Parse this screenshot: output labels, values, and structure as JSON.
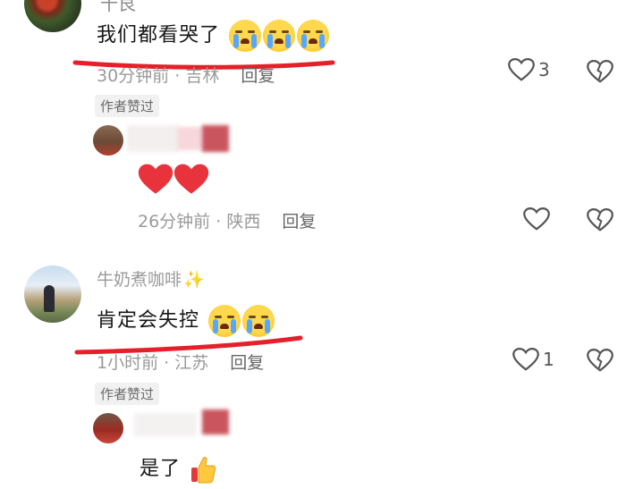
{
  "comments": [
    {
      "text": "我们都看哭了",
      "meta_time": "30分钟前",
      "meta_loc": "吉林",
      "reply_label": "回复",
      "likes": "3"
    },
    {
      "badge": "作者赞过",
      "meta_time": "26分钟前",
      "meta_loc": "陕西",
      "reply_label": "回复"
    },
    {
      "name": "牛奶煮咖啡",
      "text": "肯定会失控",
      "meta_time": "1小时前",
      "meta_loc": "江苏",
      "reply_label": "回复",
      "likes": "1"
    },
    {
      "badge": "作者赞过",
      "text": "是了"
    }
  ],
  "separator": " · ",
  "colors": {
    "annotation": "#e5202a",
    "meta": "#9a9a9a",
    "text": "#161616"
  },
  "icons": [
    "crying-face-emoji",
    "heart-outline-icon",
    "broken-heart-icon",
    "red-heart-emoji",
    "thumbs-up-emoji",
    "sparkles-emoji"
  ]
}
